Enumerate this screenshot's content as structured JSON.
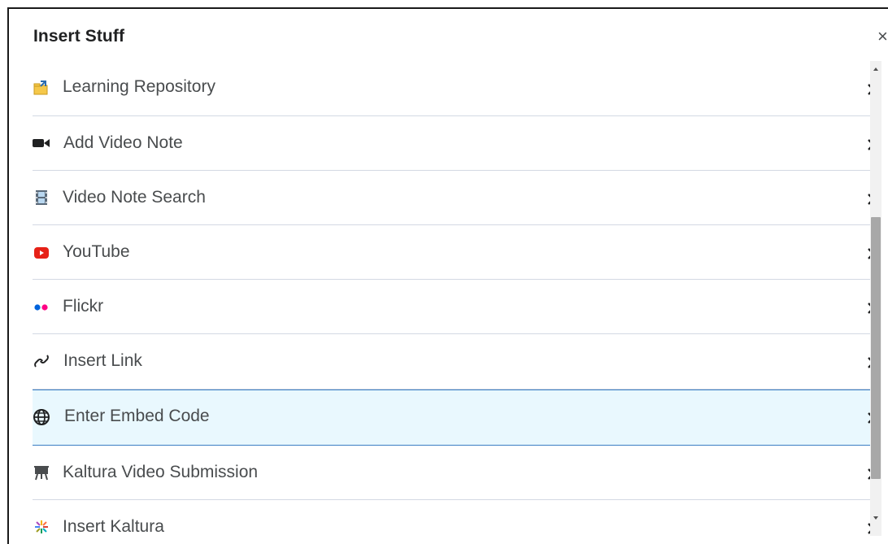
{
  "dialog": {
    "title": "Insert Stuff",
    "close_label": "×"
  },
  "items": [
    {
      "label": "Learning Repository",
      "icon": "learning-repository-icon"
    },
    {
      "label": "Add Video Note",
      "icon": "video-camera-icon"
    },
    {
      "label": "Video Note Search",
      "icon": "film-strip-icon"
    },
    {
      "label": "YouTube",
      "icon": "youtube-icon"
    },
    {
      "label": "Flickr",
      "icon": "flickr-icon"
    },
    {
      "label": "Insert Link",
      "icon": "link-icon"
    },
    {
      "label": "Enter Embed Code",
      "icon": "globe-icon",
      "selected": true
    },
    {
      "label": "Kaltura Video Submission",
      "icon": "easel-icon"
    },
    {
      "label": "Insert Kaltura",
      "icon": "kaltura-icon"
    }
  ],
  "colors": {
    "selected_bg": "#e9f8fe",
    "selected_border": "#3a7ec4",
    "youtube_red": "#e62117",
    "flickr_blue": "#0063dc",
    "flickr_pink": "#ff0084"
  }
}
